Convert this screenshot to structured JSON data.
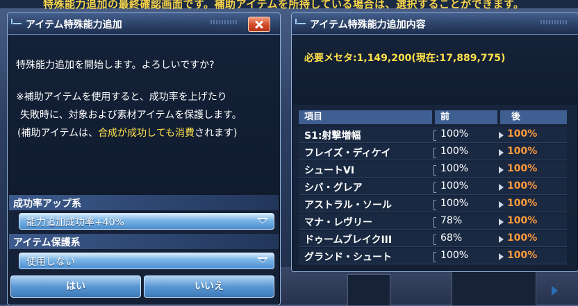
{
  "background": {
    "top_message": "特殊能力追加の最終確認画面です。補助アイテムを所持している場合は、選択することができます。"
  },
  "left_window": {
    "title": "アイテム特殊能力追加",
    "message": {
      "line1": "特殊能力追加を開始します。よろしいですか?",
      "line2": "※補助アイテムを使用すると、成功率を上げたり",
      "line3": "失敗時に、対象および素材アイテムを保護します。",
      "line4_prefix": "(補助アイテムは、",
      "line4_highlight": "合成が成功しても消費",
      "line4_suffix": "されます)"
    },
    "success_section": {
      "label": "成功率アップ系",
      "selected": "能力追加成功率+40%"
    },
    "protect_section": {
      "label": "アイテム保護系",
      "selected": "使用しない"
    },
    "buttons": {
      "yes": "はい",
      "no": "いいえ"
    }
  },
  "right_window": {
    "title": "アイテム特殊能力追加内容",
    "cost_text": "必要メセタ:1,149,200(現在:17,889,775)",
    "table": {
      "headers": {
        "item": "項目",
        "before": "前",
        "after": "後"
      },
      "rows": [
        {
          "name": "S1:射撃増幅",
          "before": "100%",
          "after": "100%"
        },
        {
          "name": "フレイズ・ディケイ",
          "before": "100%",
          "after": "100%"
        },
        {
          "name": "シュートVI",
          "before": "100%",
          "after": "100%"
        },
        {
          "name": "シバ・グレア",
          "before": "100%",
          "after": "100%"
        },
        {
          "name": "アストラル・ソール",
          "before": "100%",
          "after": "100%"
        },
        {
          "name": "マナ・レヴリー",
          "before": "78%",
          "after": "100%"
        },
        {
          "name": "ドゥームブレイクIII",
          "before": "68%",
          "after": "100%"
        },
        {
          "name": "グランド・シュート",
          "before": "100%",
          "after": "100%"
        }
      ]
    }
  },
  "colors": {
    "highlight_yellow": "#ffe14a",
    "after_value_orange": "#ff9a3c",
    "button_blue": "#5b98d4",
    "close_red": "#d04a28"
  }
}
